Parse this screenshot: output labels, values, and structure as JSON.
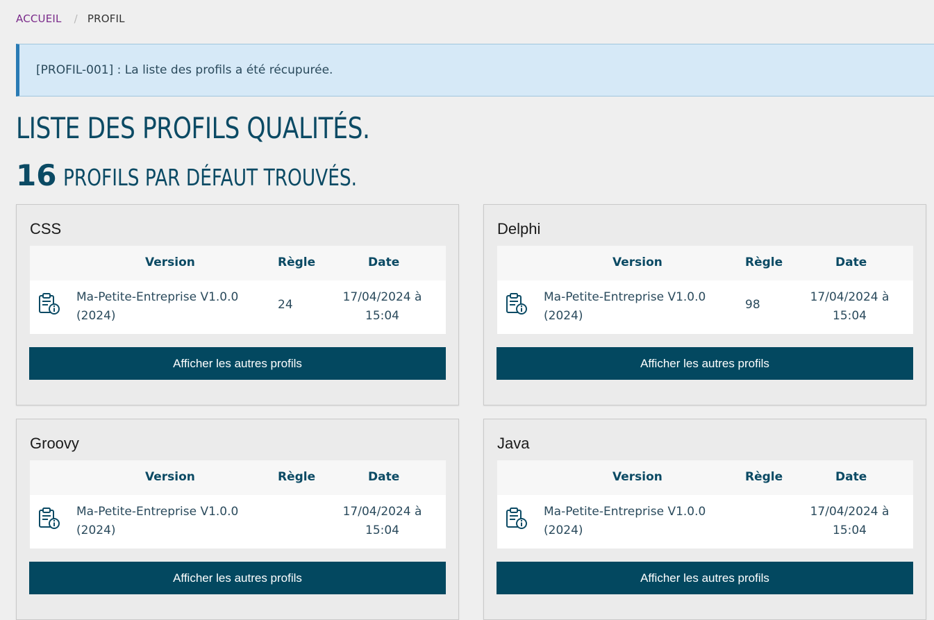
{
  "breadcrumb": {
    "home": "ACCUEIL",
    "separator": "/",
    "current": "PROFIL"
  },
  "alert": {
    "message": "[PROFIL-001] : La liste des profils a été récupurée."
  },
  "heading": {
    "title": "LISTE DES PROFILS QUALITÉS.",
    "count": "16",
    "count_suffix": "PROFILS PAR DÉFAUT TROUVÉS."
  },
  "table_headers": {
    "version": "Version",
    "regle": "Règle",
    "date": "Date"
  },
  "button_label": "Afficher les autres profils",
  "profiles": [
    {
      "language": "CSS",
      "version": "Ma-Petite-Entreprise V1.0.0 (2024)",
      "regle": "24",
      "date": "17/04/2024 à 15:04"
    },
    {
      "language": "Delphi",
      "version": "Ma-Petite-Entreprise V1.0.0 (2024)",
      "regle": "98",
      "date": "17/04/2024 à 15:04"
    },
    {
      "language": "Groovy",
      "version": "Ma-Petite-Entreprise V1.0.0 (2024)",
      "regle": "",
      "date": "17/04/2024 à 15:04"
    },
    {
      "language": "Java",
      "version": "Ma-Petite-Entreprise V1.0.0 (2024)",
      "regle": "",
      "date": "17/04/2024 à 15:04"
    }
  ]
}
